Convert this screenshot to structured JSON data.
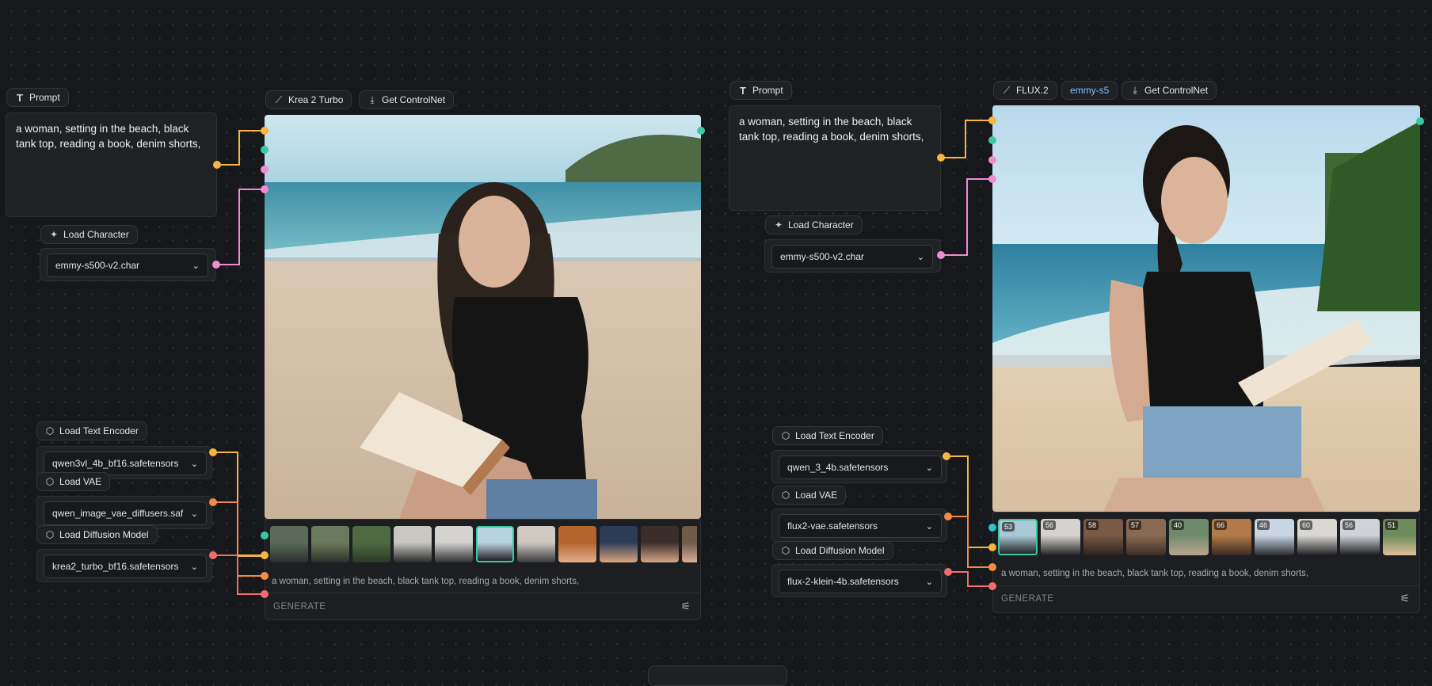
{
  "left": {
    "prompt": {
      "label": "Prompt",
      "icon": "text-t-icon",
      "text": "a woman, setting in the beach, black tank top, reading a book, denim shorts,"
    },
    "load_character": {
      "label": "Load Character",
      "value": "emmy-s500-v2.char"
    },
    "model_chip": {
      "label": "Krea 2 Turbo"
    },
    "controlnet_chip": {
      "label": "Get ControlNet"
    },
    "text_encoder": {
      "label": "Load Text Encoder",
      "value": "qwen3vl_4b_bf16.safetensors"
    },
    "vae": {
      "label": "Load VAE",
      "value": "qwen_image_vae_diffusers.saf"
    },
    "diffusion": {
      "label": "Load Diffusion Model",
      "value": "krea2_turbo_bf16.safetensors"
    },
    "output": {
      "caption": "a woman, setting in the beach, black tank top, reading a book, denim shorts,",
      "generate": "GENERATE"
    },
    "thumbs": [
      {
        "colors": [
          "#5a6b5a",
          "#2c2f2e"
        ],
        "badge": ""
      },
      {
        "colors": [
          "#6b7a5c",
          "#2b2e2a"
        ],
        "badge": ""
      },
      {
        "colors": [
          "#4d6a42",
          "#2a3a25"
        ],
        "badge": ""
      },
      {
        "colors": [
          "#c9c7c2",
          "#2a2a2c"
        ],
        "badge": ""
      },
      {
        "colors": [
          "#d4d2cf",
          "#303033"
        ],
        "badge": ""
      },
      {
        "colors": [
          "#b9d3df",
          "#1e1e21"
        ],
        "badge": ""
      },
      {
        "colors": [
          "#cfc9c2",
          "#3a3a3d"
        ],
        "badge": ""
      },
      {
        "colors": [
          "#b5652f",
          "#e0b08a"
        ],
        "badge": ""
      },
      {
        "colors": [
          "#2d3b57",
          "#d9a77d"
        ],
        "badge": ""
      },
      {
        "colors": [
          "#3b2e2a",
          "#d5a586"
        ],
        "badge": ""
      },
      {
        "colors": [
          "#6c5a4a",
          "#d8b096"
        ],
        "badge": ""
      },
      {
        "colors": [
          "#5a4a3e",
          "#2c2520"
        ],
        "badge": ""
      }
    ]
  },
  "right": {
    "prompt": {
      "label": "Prompt",
      "icon": "text-t-icon",
      "text": "a woman, setting in the beach, black tank top, reading a book, denim shorts,"
    },
    "load_character": {
      "label": "Load Character",
      "value": "emmy-s500-v2.char"
    },
    "model_chip": {
      "label": "FLUX.2"
    },
    "char_chip": {
      "label": "emmy-s5"
    },
    "controlnet_chip": {
      "label": "Get ControlNet"
    },
    "text_encoder": {
      "label": "Load Text Encoder",
      "value": "qwen_3_4b.safetensors"
    },
    "vae": {
      "label": "Load VAE",
      "value": "flux2-vae.safetensors"
    },
    "diffusion": {
      "label": "Load Diffusion Model",
      "value": "flux-2-klein-4b.safetensors"
    },
    "output": {
      "caption": "a woman, setting in the beach, black tank top, reading a book, denim shorts,",
      "generate": "GENERATE"
    },
    "thumbs": [
      {
        "colors": [
          "#a9c9d6",
          "#232325"
        ],
        "badge": "53"
      },
      {
        "colors": [
          "#d5d3cf",
          "#222224"
        ],
        "badge": "56"
      },
      {
        "colors": [
          "#7a5a44",
          "#2a2220"
        ],
        "badge": "58"
      },
      {
        "colors": [
          "#8a6a52",
          "#3b2d25"
        ],
        "badge": "57"
      },
      {
        "colors": [
          "#6f8a6a",
          "#b9a58c"
        ],
        "badge": "40"
      },
      {
        "colors": [
          "#b27a4a",
          "#3a2a22"
        ],
        "badge": "66"
      },
      {
        "colors": [
          "#c8d6e3",
          "#2b2c2f"
        ],
        "badge": "46"
      },
      {
        "colors": [
          "#d9d7d2",
          "#1f2023"
        ],
        "badge": "60"
      },
      {
        "colors": [
          "#cfd3d8",
          "#1b1c20"
        ],
        "badge": "56"
      },
      {
        "colors": [
          "#6c8a5a",
          "#e1c09a"
        ],
        "badge": "51"
      }
    ]
  },
  "colors": {
    "yellow": "#f6b63f",
    "green": "#3bc9a4",
    "pink": "#f08bd2",
    "orange": "#f38b48",
    "red": "#f36d6d",
    "cyan": "#30c3c9"
  }
}
